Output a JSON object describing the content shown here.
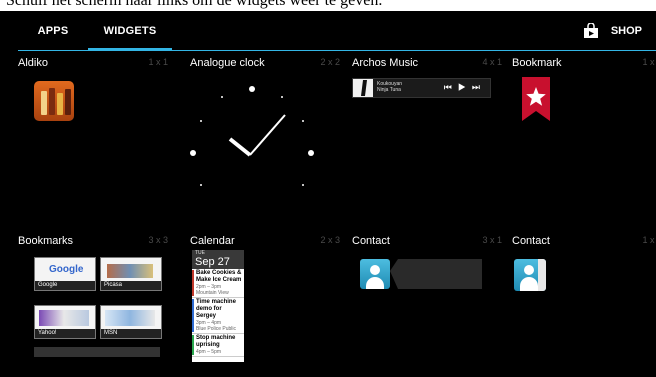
{
  "caption": "Schuif het scherm naar links om de widgets weer te geven.",
  "tabs": {
    "apps": "APPS",
    "widgets": "WIDGETS"
  },
  "shop": {
    "label": "SHOP",
    "icon": "shopping-bag-icon"
  },
  "colors": {
    "accent": "#33b5e5",
    "background": "#000000",
    "size_text": "#4a4a4a"
  },
  "widgets": [
    {
      "name": "Aldiko",
      "size": "1 x 1",
      "icon": "bookshelf-icon"
    },
    {
      "name": "Analogue clock",
      "size": "2 x 2",
      "icon": "clock-icon"
    },
    {
      "name": "Archos Music",
      "size": "4 x 1",
      "track": "Koukouyan",
      "artist": "Ninja Tuna",
      "controls": {
        "prev": "⏮",
        "play": "▶",
        "next": "⏭"
      }
    },
    {
      "name": "Bookmark",
      "size": "1 x 1",
      "icon": "bookmark-star-icon"
    },
    {
      "name": "Bookmarks",
      "size": "3 x 3",
      "thumbs": [
        {
          "label": "Google",
          "logo": "Google"
        },
        {
          "label": "Picasa"
        },
        {
          "label": "Yahoo!"
        },
        {
          "label": "MSN"
        }
      ]
    },
    {
      "name": "Calendar",
      "size": "2 x 3",
      "day": "TUE",
      "date": "Sep 27",
      "events": [
        {
          "title": "Bake Cookies & Make Ice Cream",
          "time": "2pm – 3pm",
          "place": "Mountain View",
          "color": "#c0392b"
        },
        {
          "title": "Time machine demo for Sergey",
          "time": "3pm – 4pm",
          "place": "Blue Police Public",
          "color": "#2e6bd1"
        },
        {
          "title": "Stop machine uprising",
          "time": "4pm – 5pm",
          "place": "",
          "color": "#2aa84f"
        }
      ]
    },
    {
      "name": "Contact",
      "size": "3 x 1",
      "icon": "contact-avatar-icon"
    },
    {
      "name": "Contact",
      "size": "1 x 1",
      "icon": "contact-card-icon"
    }
  ]
}
